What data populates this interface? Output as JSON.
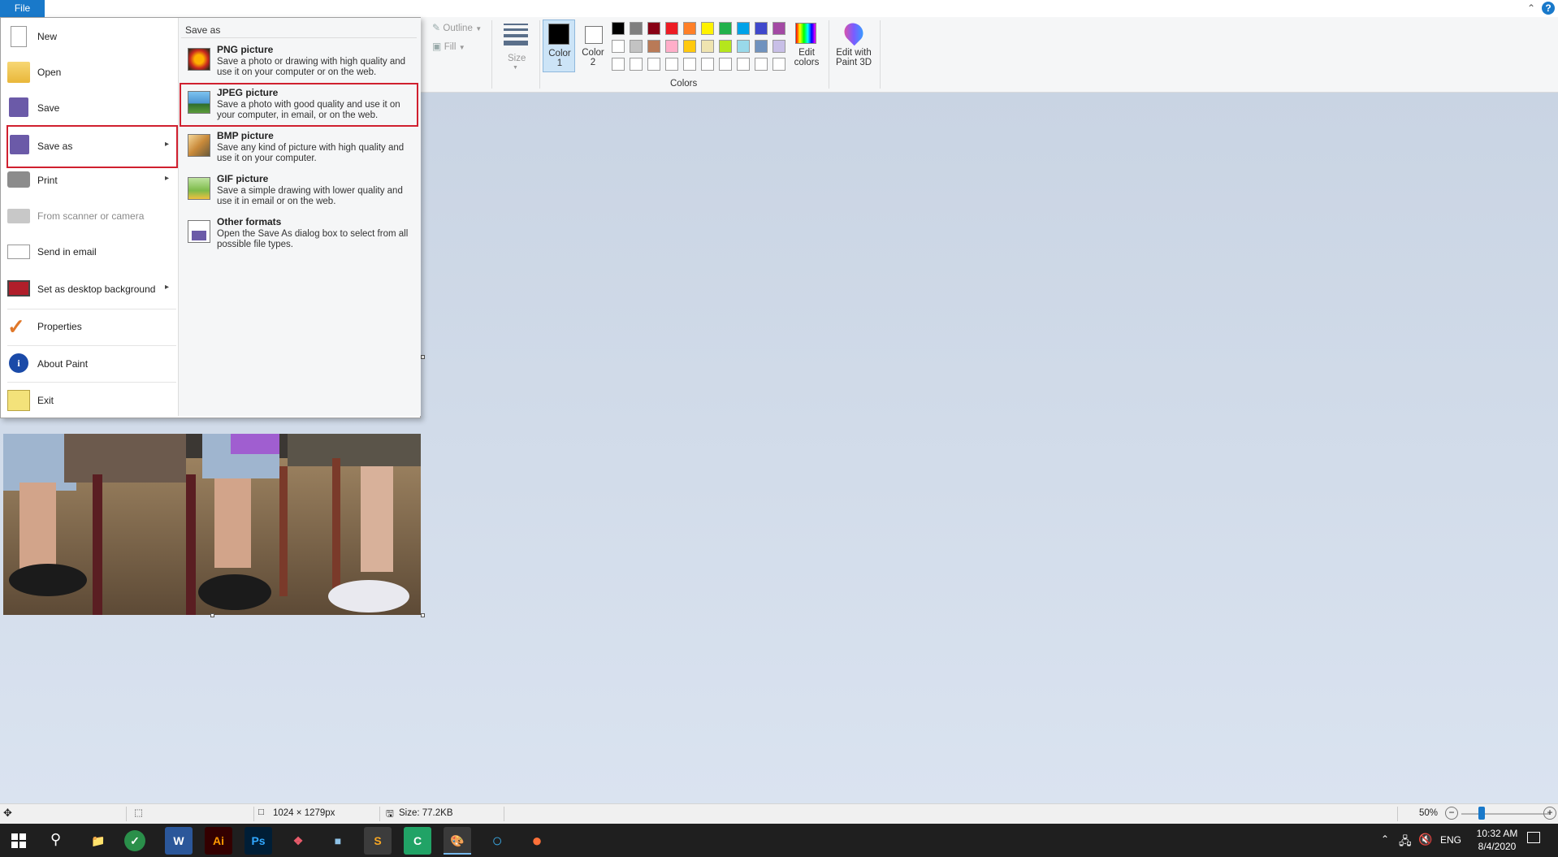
{
  "titlebar": {
    "file_tab": "File",
    "help": "?"
  },
  "ribbon": {
    "outline_label": "Outline",
    "fill_label": "Fill",
    "size_label": "Size",
    "color1_label": "Color 1",
    "color2_label": "Color 2",
    "edit_colors_label": "Edit colors",
    "edit_paint3d_label": "Edit with Paint 3D",
    "colors_group_label": "Colors",
    "color1_value": "#000000",
    "color2_value": "#ffffff",
    "palette_row1": [
      "#000000",
      "#7f7f7f",
      "#880015",
      "#ed1c24",
      "#ff7f27",
      "#fff200",
      "#22b14c",
      "#00a2e8",
      "#3f48cc",
      "#a349a4"
    ],
    "palette_row2": [
      "#ffffff",
      "#c3c3c3",
      "#b97a57",
      "#ffaec9",
      "#ffc90e",
      "#efe4b0",
      "#b5e61d",
      "#99d9ea",
      "#7092be",
      "#c8bfe7"
    ],
    "palette_row3": [
      "#ffffff",
      "#ffffff",
      "#ffffff",
      "#ffffff",
      "#ffffff",
      "#ffffff",
      "#ffffff",
      "#ffffff",
      "#ffffff",
      "#ffffff"
    ]
  },
  "file_menu": {
    "items": [
      {
        "label": "New",
        "icon": "new-file-icon"
      },
      {
        "label": "Open",
        "icon": "open-folder-icon"
      },
      {
        "label": "Save",
        "icon": "floppy-disk-icon"
      },
      {
        "label": "Save as",
        "icon": "save-as-icon"
      },
      {
        "label": "Print",
        "icon": "printer-icon"
      },
      {
        "label": "From scanner or camera",
        "icon": "scanner-icon"
      },
      {
        "label": "Send in email",
        "icon": "email-icon"
      },
      {
        "label": "Set as desktop background",
        "icon": "desktop-icon"
      },
      {
        "label": "Properties",
        "icon": "checkmark-icon"
      },
      {
        "label": "About Paint",
        "icon": "info-icon"
      },
      {
        "label": "Exit",
        "icon": "exit-icon"
      }
    ],
    "submenu": {
      "header": "Save as",
      "items": [
        {
          "title": "PNG picture",
          "desc": "Save a photo or drawing with high quality and use it on your computer or on the web."
        },
        {
          "title": "JPEG picture",
          "desc": "Save a photo with good quality and use it on your computer, in email, or on the web."
        },
        {
          "title": "BMP picture",
          "desc": "Save any kind of picture with high quality and use it on your computer."
        },
        {
          "title": "GIF picture",
          "desc": "Save a simple drawing with lower quality and use it in email or on the web."
        },
        {
          "title": "Other formats",
          "desc": "Open the Save As dialog box to select from all possible file types."
        }
      ]
    }
  },
  "statusbar": {
    "dimensions": "1024 × 1279px",
    "size": "Size: 77.2KB",
    "zoom": "50%"
  },
  "taskbar": {
    "time": "10:32 AM",
    "date": "8/4/2020",
    "language": "ENG"
  }
}
